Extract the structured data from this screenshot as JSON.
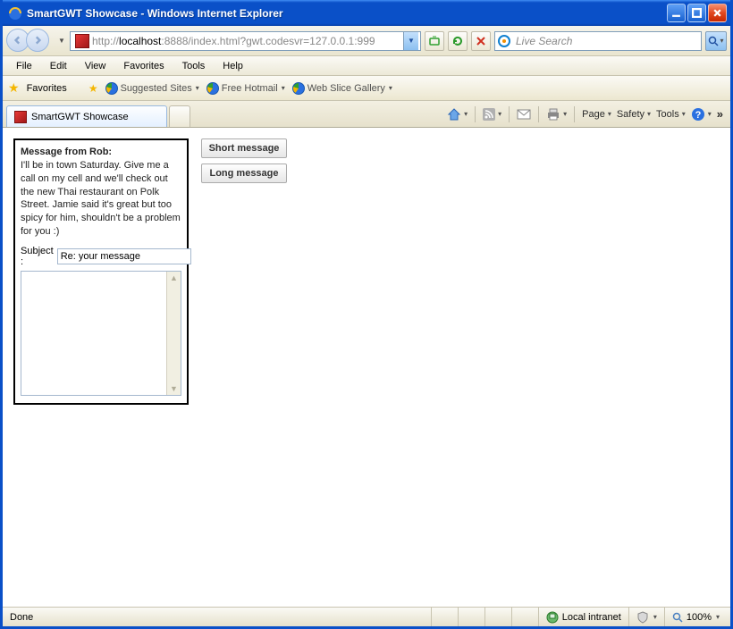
{
  "window": {
    "title": "SmartGWT Showcase - Windows Internet Explorer"
  },
  "address_bar": {
    "prefix": "http://",
    "host": "localhost",
    "rest": ":8888/index.html?gwt.codesvr=127.0.0.1:999"
  },
  "search": {
    "placeholder": "Live Search"
  },
  "menu": {
    "items": [
      "File",
      "Edit",
      "View",
      "Favorites",
      "Tools",
      "Help"
    ]
  },
  "favorites_bar": {
    "label": "Favorites",
    "links": [
      "Suggested Sites",
      "Free Hotmail",
      "Web Slice Gallery"
    ]
  },
  "tabs": {
    "active": "SmartGWT Showcase"
  },
  "command_bar": {
    "items": [
      "Page",
      "Safety",
      "Tools"
    ]
  },
  "content": {
    "message_heading": "Message from Rob:",
    "message_body": "I'll be in town Saturday. Give me a call on my cell and we'll check out the new Thai restaurant on Polk Street. Jamie said it's great but too spicy for him, shouldn't be a problem for you :)",
    "subject_label": "Subject :",
    "subject_value": "Re: your message",
    "buttons": {
      "short": "Short message",
      "long": "Long message"
    }
  },
  "status_bar": {
    "left": "Done",
    "zone": "Local intranet",
    "zoom": "100%"
  }
}
